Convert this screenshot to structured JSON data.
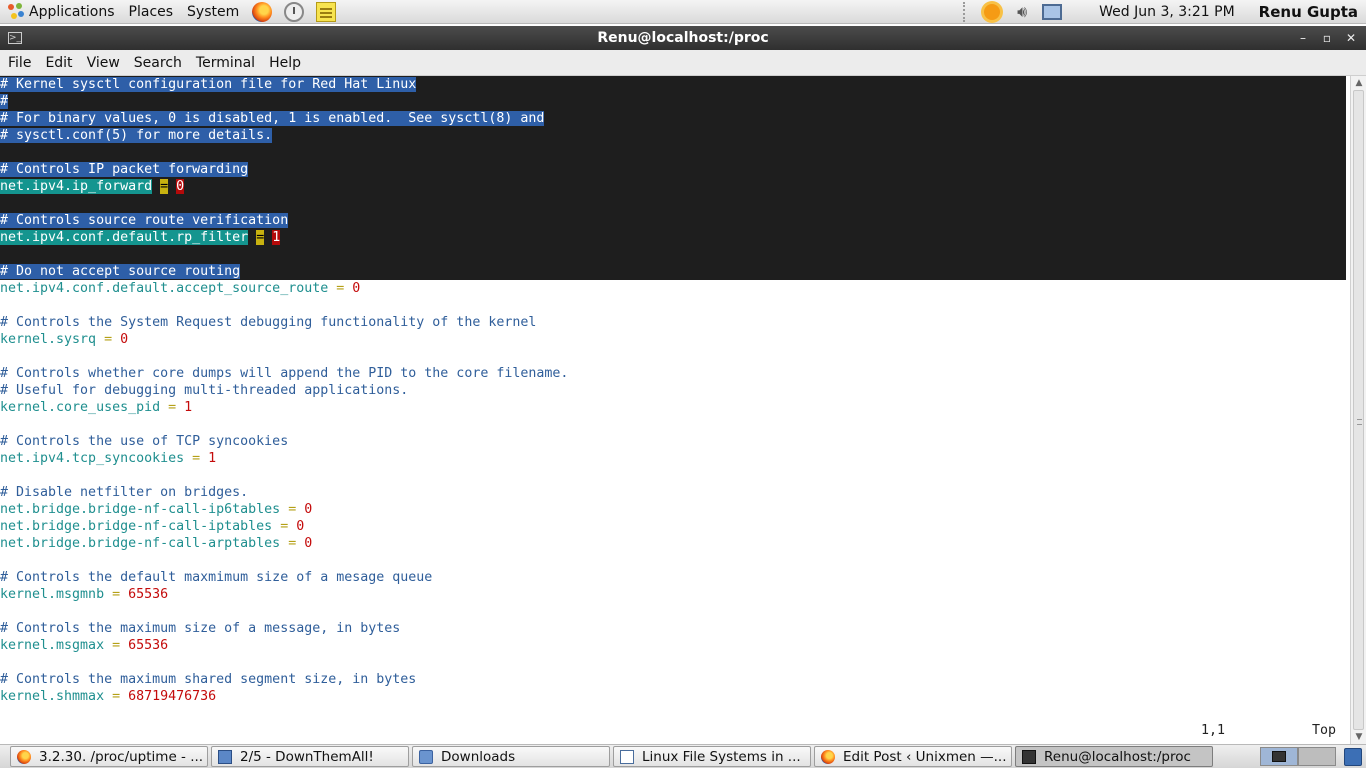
{
  "top_panel": {
    "menus": [
      "Applications",
      "Places",
      "System"
    ],
    "clock": "Wed Jun  3,  3:21 PM",
    "user": "Renu Gupta"
  },
  "window": {
    "title": "Renu@localhost:/proc"
  },
  "menubar": [
    "File",
    "Edit",
    "View",
    "Search",
    "Terminal",
    "Help"
  ],
  "terminal": {
    "lines": [
      {
        "type": "comment",
        "selected": true,
        "text": "# Kernel sysctl configuration file for Red Hat Linux"
      },
      {
        "type": "comment",
        "selected": true,
        "text": "#"
      },
      {
        "type": "comment",
        "selected": true,
        "text": "# For binary values, 0 is disabled, 1 is enabled.  See sysctl(8) and"
      },
      {
        "type": "comment",
        "selected": true,
        "text": "# sysctl.conf(5) for more details."
      },
      {
        "type": "blank",
        "selected": true,
        "text": ""
      },
      {
        "type": "comment",
        "selected": true,
        "text": "# Controls IP packet forwarding"
      },
      {
        "type": "setting",
        "selected": true,
        "key": "net.ipv4.ip_forward",
        "value": "0"
      },
      {
        "type": "blank",
        "selected": true,
        "text": ""
      },
      {
        "type": "comment",
        "selected": true,
        "text": "# Controls source route verification"
      },
      {
        "type": "setting",
        "selected": true,
        "key": "net.ipv4.conf.default.rp_filter",
        "value": "1"
      },
      {
        "type": "blank",
        "selected": true,
        "text": ""
      },
      {
        "type": "comment",
        "selected": true,
        "text": "# Do not accept source routing"
      },
      {
        "type": "setting",
        "selected": false,
        "key": "net.ipv4.conf.default.accept_source_route",
        "value": "0"
      },
      {
        "type": "blank",
        "selected": false,
        "text": ""
      },
      {
        "type": "comment",
        "selected": false,
        "text": "# Controls the System Request debugging functionality of the kernel"
      },
      {
        "type": "setting",
        "selected": false,
        "key": "kernel.sysrq",
        "value": "0"
      },
      {
        "type": "blank",
        "selected": false,
        "text": ""
      },
      {
        "type": "comment",
        "selected": false,
        "text": "# Controls whether core dumps will append the PID to the core filename."
      },
      {
        "type": "comment",
        "selected": false,
        "text": "# Useful for debugging multi-threaded applications."
      },
      {
        "type": "setting",
        "selected": false,
        "key": "kernel.core_uses_pid",
        "value": "1"
      },
      {
        "type": "blank",
        "selected": false,
        "text": ""
      },
      {
        "type": "comment",
        "selected": false,
        "text": "# Controls the use of TCP syncookies"
      },
      {
        "type": "setting",
        "selected": false,
        "key": "net.ipv4.tcp_syncookies",
        "value": "1"
      },
      {
        "type": "blank",
        "selected": false,
        "text": ""
      },
      {
        "type": "comment",
        "selected": false,
        "text": "# Disable netfilter on bridges."
      },
      {
        "type": "setting",
        "selected": false,
        "key": "net.bridge.bridge-nf-call-ip6tables",
        "value": "0"
      },
      {
        "type": "setting",
        "selected": false,
        "key": "net.bridge.bridge-nf-call-iptables",
        "value": "0"
      },
      {
        "type": "setting",
        "selected": false,
        "key": "net.bridge.bridge-nf-call-arptables",
        "value": "0"
      },
      {
        "type": "blank",
        "selected": false,
        "text": ""
      },
      {
        "type": "comment",
        "selected": false,
        "text": "# Controls the default maxmimum size of a mesage queue"
      },
      {
        "type": "setting",
        "selected": false,
        "key": "kernel.msgmnb",
        "value": "65536"
      },
      {
        "type": "blank",
        "selected": false,
        "text": ""
      },
      {
        "type": "comment",
        "selected": false,
        "text": "# Controls the maximum size of a message, in bytes"
      },
      {
        "type": "setting",
        "selected": false,
        "key": "kernel.msgmax",
        "value": "65536"
      },
      {
        "type": "blank",
        "selected": false,
        "text": ""
      },
      {
        "type": "comment",
        "selected": false,
        "text": "# Controls the maximum shared segment size, in bytes"
      },
      {
        "type": "setting",
        "selected": false,
        "key": "kernel.shmmax",
        "value": "68719476736"
      }
    ],
    "status_position": "1,1",
    "status_scroll": "Top"
  },
  "taskbar": {
    "tasks": [
      {
        "label": "3.2.30. /proc/uptime - ...",
        "icon": "firefox-icon",
        "active": false
      },
      {
        "label": "2/5 - DownThemAll!",
        "icon": "downthemall-icon",
        "active": false
      },
      {
        "label": "Downloads",
        "icon": "folder-icon",
        "active": false
      },
      {
        "label": "Linux File Systems in ...",
        "icon": "document-icon",
        "active": false
      },
      {
        "label": "Edit Post ‹ Unixmen —...",
        "icon": "firefox-icon",
        "active": false
      },
      {
        "label": "Renu@localhost:/proc",
        "icon": "terminal-icon",
        "active": true
      }
    ]
  },
  "colors": {
    "comment": "#2f5e9a",
    "key": "#1f8f8f",
    "equals": "#b5a017",
    "value": "#c40b0b",
    "selection_bg": "#1e1e1e"
  }
}
